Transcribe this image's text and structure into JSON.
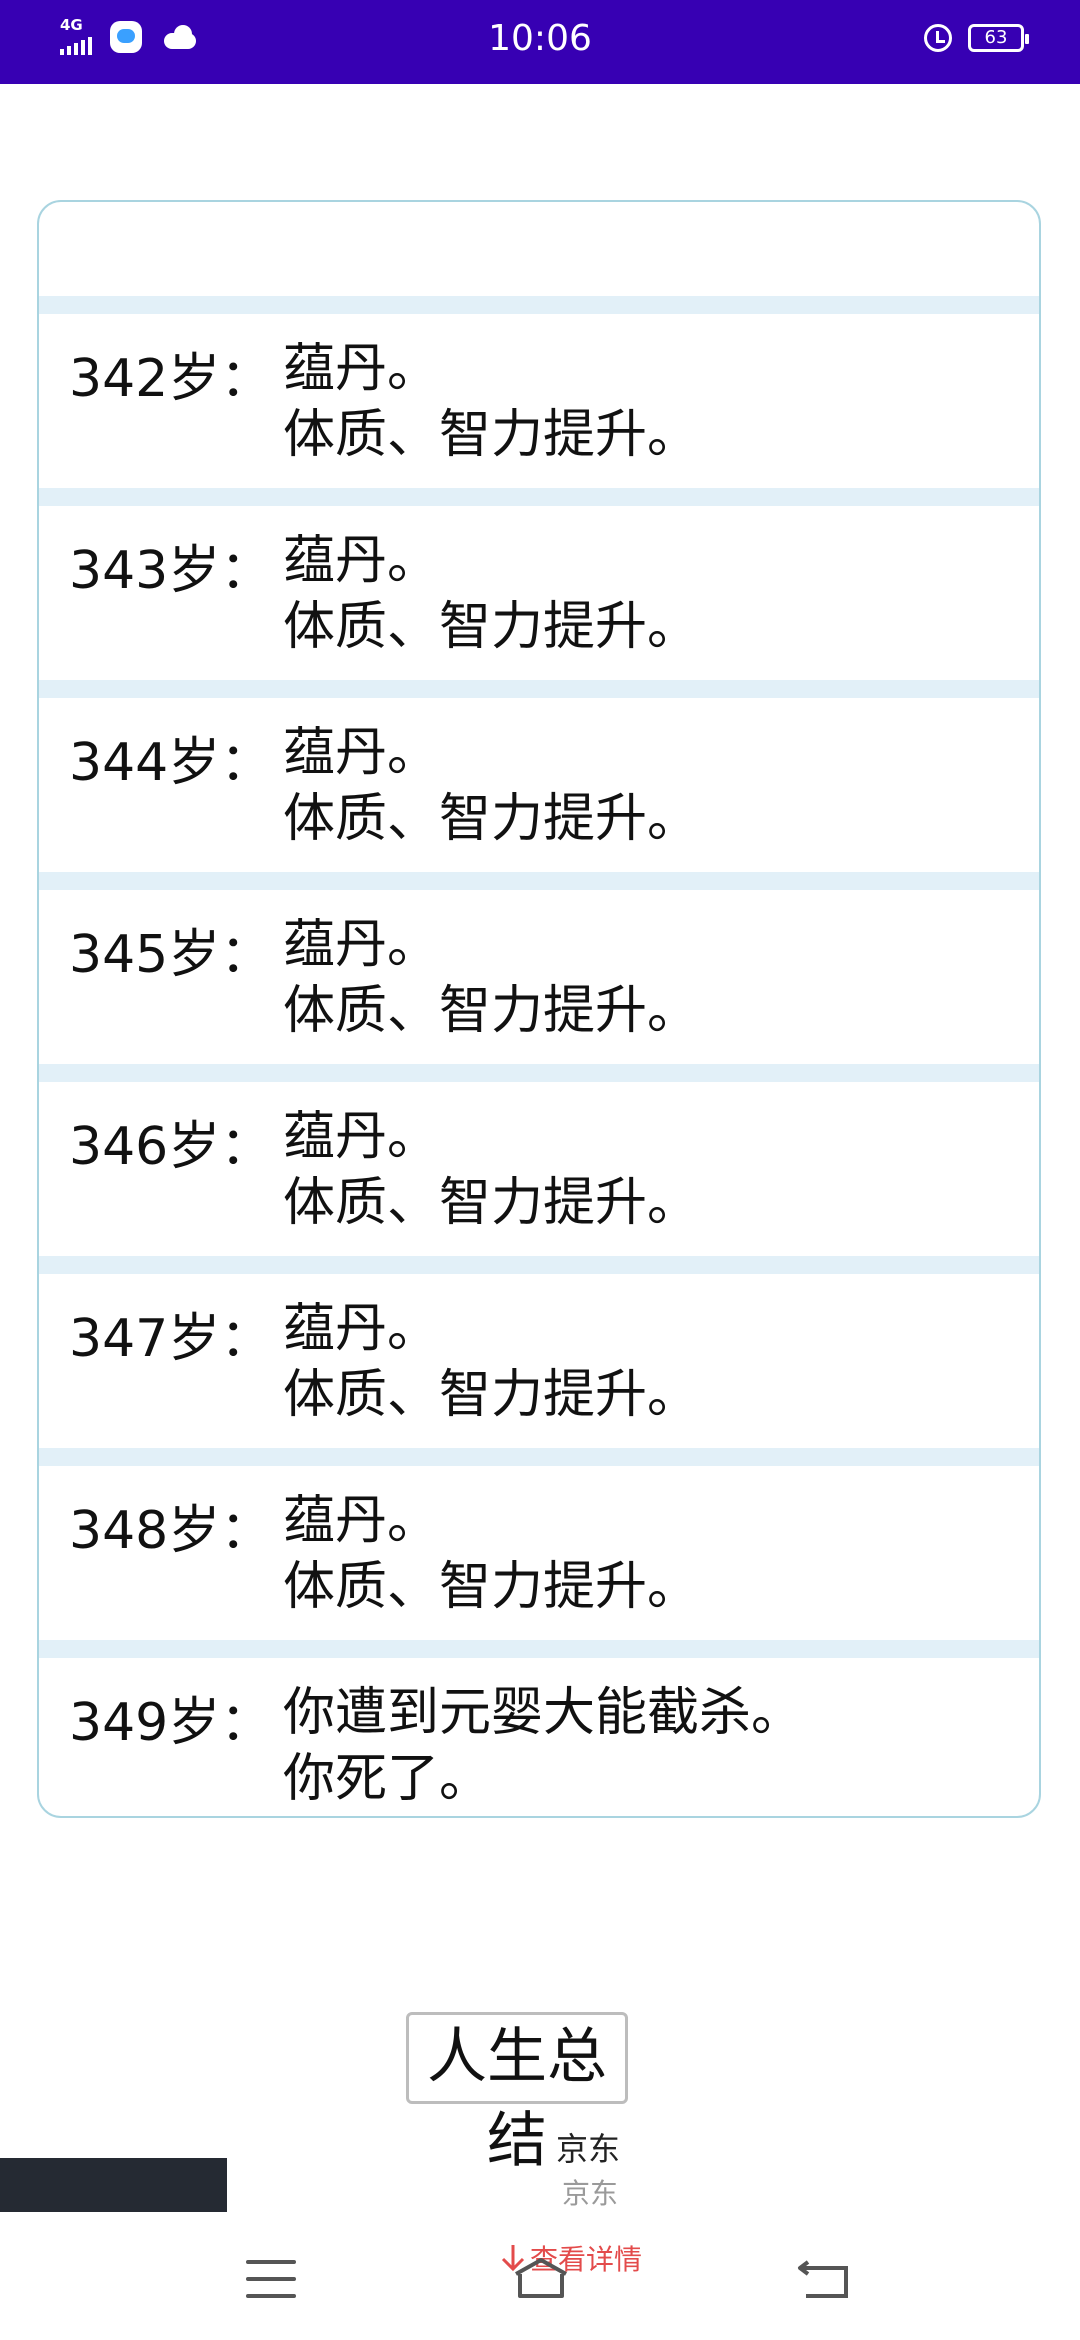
{
  "status_bar": {
    "network": "4G",
    "time": "10:06",
    "battery": "63"
  },
  "events": [
    {
      "age": "",
      "lines": [
        "体质、智力提升。"
      ]
    },
    {
      "age": "342岁：",
      "lines": [
        "蕴丹。",
        "体质、智力提升。"
      ]
    },
    {
      "age": "343岁：",
      "lines": [
        "蕴丹。",
        "体质、智力提升。"
      ]
    },
    {
      "age": "344岁：",
      "lines": [
        "蕴丹。",
        "体质、智力提升。"
      ]
    },
    {
      "age": "345岁：",
      "lines": [
        "蕴丹。",
        "体质、智力提升。"
      ]
    },
    {
      "age": "346岁：",
      "lines": [
        "蕴丹。",
        "体质、智力提升。"
      ]
    },
    {
      "age": "347岁：",
      "lines": [
        "蕴丹。",
        "体质、智力提升。"
      ]
    },
    {
      "age": "348岁：",
      "lines": [
        "蕴丹。",
        "体质、智力提升。"
      ]
    },
    {
      "age": "349岁：",
      "lines": [
        "你遭到元婴大能截杀。",
        "你死了。"
      ]
    }
  ],
  "summary_button": "人生总结",
  "ad": {
    "brand": "京东",
    "brand_sub": "京东",
    "link": "查看详情"
  },
  "icons": {
    "menu": "menu-icon",
    "home": "home-icon",
    "back": "back-icon"
  }
}
